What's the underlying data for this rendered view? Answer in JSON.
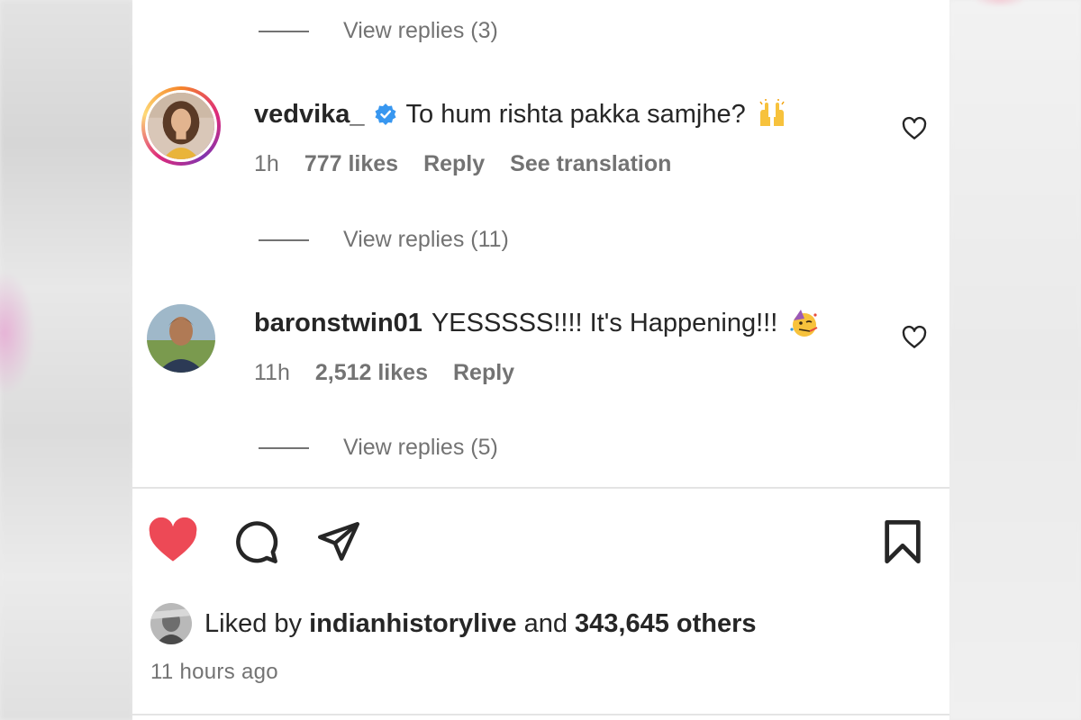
{
  "replies": {
    "top_label": "View replies (3)",
    "middle_label": "View replies (11)",
    "bottom_label": "View replies (5)"
  },
  "comments": [
    {
      "username": "vedvika_",
      "verified": true,
      "text": "To hum rishta pakka samjhe?",
      "emoji": "raising-hands-emoji",
      "time": "1h",
      "likes": "777 likes",
      "reply": "Reply",
      "translate": "See translation"
    },
    {
      "username": "baronstwin01",
      "verified": false,
      "text": "YESSSSS!!!! It's Happening!!!",
      "emoji": "partying-face-emoji",
      "time": "11h",
      "likes": "2,512 likes",
      "reply": "Reply"
    }
  ],
  "post": {
    "liked": true,
    "like_color": "#ed4956",
    "liked_by_prefix": "Liked by",
    "liked_by_user": "indianhistorylive",
    "liked_by_and": "and",
    "liked_by_count": "343,645 others",
    "time_ago": "11 hours ago"
  },
  "icons": [
    "heart-icon",
    "comment-icon",
    "share-icon",
    "bookmark-icon",
    "verified-badge-icon"
  ]
}
